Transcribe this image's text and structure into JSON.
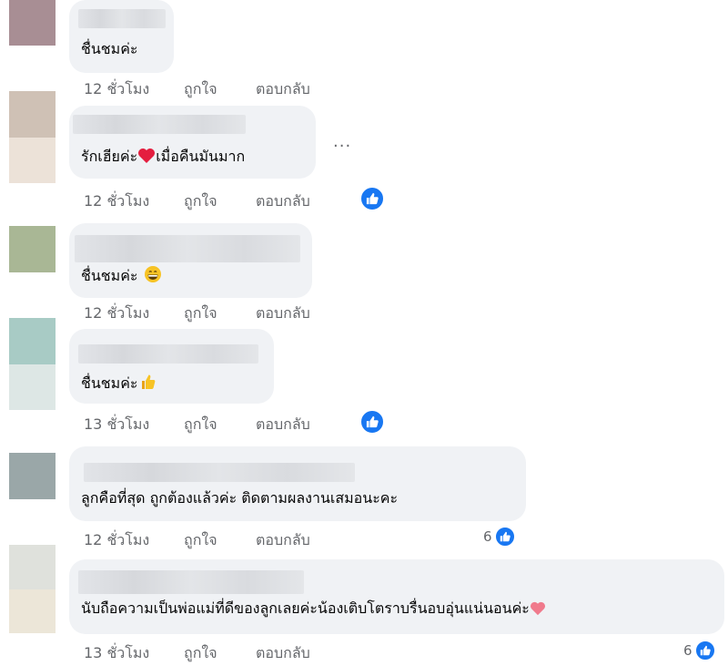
{
  "comments": [
    {
      "text": "ชื่นชมค่ะ",
      "time": "12 ชั่วโมง"
    },
    {
      "text": "รักเฮียค่ะ",
      "text_after": "เมื่อคืนมันมาก",
      "time": "12 ชั่วโมง"
    },
    {
      "text": "ชื่นชมค่ะ",
      "time": "12 ชั่วโมง"
    },
    {
      "text": "ชื่นชมค่ะ",
      "time": "13 ชั่วโมง"
    },
    {
      "text": "ลูกคือที่สุด ถูกต้องแล้วค่ะ ติดตามผลงานเสมอนะคะ",
      "time": "12 ชั่วโมง",
      "reaction_count": "6"
    },
    {
      "text": "นับถือความเป็นพ่อแม่ที่ดีของลูกเลยค่ะน้องเติบโตราบรื่นอบอุ่นแน่นอนค่ะ",
      "time": "13 ชั่วโมง",
      "reaction_count": "6"
    }
  ],
  "actions": {
    "like": "ถูกใจ",
    "reply": "ตอบกลับ"
  },
  "more_label": "...",
  "colors": {
    "bubble": "#f0f2f5",
    "like_blue": "#1877f2",
    "meta_gray": "#65676b"
  },
  "icons": [
    "like-thumb-icon",
    "heart-emoji-icon",
    "grin-emoji-icon",
    "thumbs-up-emoji-icon",
    "more-options-icon"
  ]
}
